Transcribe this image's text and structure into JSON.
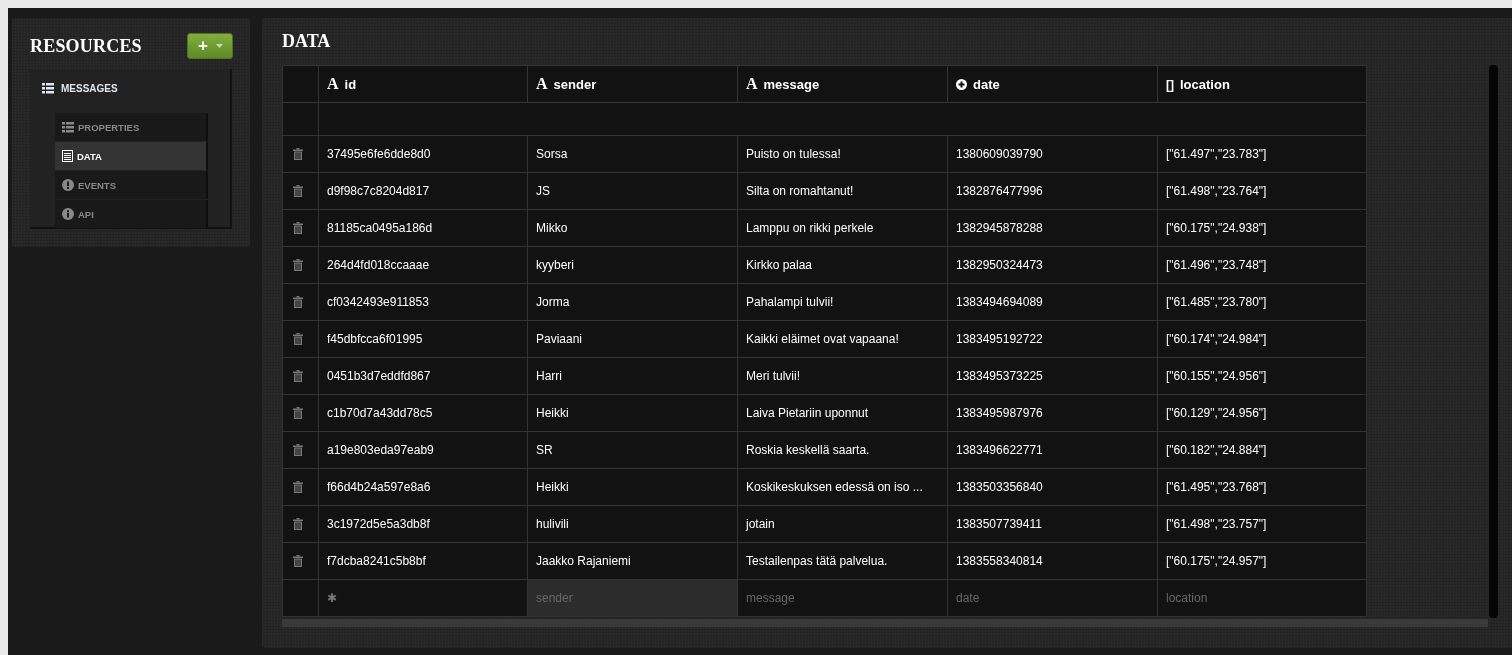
{
  "sidebar": {
    "title": "RESOURCES",
    "add_button": {
      "label": "+"
    },
    "resources": [
      {
        "label": "MESSAGES",
        "kind": "list",
        "children": [
          {
            "label": "PROPERTIES",
            "kind": "list",
            "selected": false
          },
          {
            "label": "DATA",
            "kind": "table",
            "selected": true
          },
          {
            "label": "EVENTS",
            "kind": "alert",
            "selected": false
          },
          {
            "label": "API",
            "kind": "info",
            "selected": false
          }
        ]
      }
    ]
  },
  "main": {
    "title": "DATA",
    "table": {
      "columns": [
        {
          "label": "id",
          "kind": "string",
          "glyph": "A"
        },
        {
          "label": "sender",
          "kind": "string",
          "glyph": "A"
        },
        {
          "label": "message",
          "kind": "string",
          "glyph": "A"
        },
        {
          "label": "date",
          "kind": "number"
        },
        {
          "label": "location",
          "kind": "array",
          "glyph": "[]"
        }
      ],
      "rows": [
        [
          "37495e6fe6dde8d0",
          "Sorsa",
          "Puisto on tulessa!",
          "1380609039790",
          "[\"61.497\",\"23.783\"]"
        ],
        [
          "d9f98c7c8204d817",
          "JS",
          "Silta on romahtanut!",
          "1382876477996",
          "[\"61.498\",\"23.764\"]"
        ],
        [
          "81185ca0495a186d",
          "Mikko",
          "Lamppu on rikki perkele",
          "1382945878288",
          "[\"60.175\",\"24.938\"]"
        ],
        [
          "264d4fd018ccaaae",
          "kyyberi",
          "Kirkko palaa",
          "1382950324473",
          "[\"61.496\",\"23.748\"]"
        ],
        [
          "cf0342493e911853",
          "Jorma",
          "Pahalampi tulvii!",
          "1383494694089",
          "[\"61.485\",\"23.780\"]"
        ],
        [
          "f45dbfcca6f01995",
          "Paviaani",
          "Kaikki eläimet ovat vapaana!",
          "1383495192722",
          "[\"60.174\",\"24.984\"]"
        ],
        [
          "0451b3d7eddfd867",
          "Harri",
          "Meri tulvii!",
          "1383495373225",
          "[\"60.155\",\"24.956\"]"
        ],
        [
          "c1b70d7a43dd78c5",
          "Heikki",
          "Laiva Pietariin uponnut",
          "1383495987976",
          "[\"60.129\",\"24.956\"]"
        ],
        [
          "a19e803eda97eab9",
          "SR",
          "Roskia keskellä saarta.",
          "1383496622771",
          "[\"60.182\",\"24.884\"]"
        ],
        [
          "f66d4b24a597e8a6",
          "Heikki",
          "Koskikeskuksen edessä on iso ...",
          "1383503356840",
          "[\"61.495\",\"23.768\"]"
        ],
        [
          "3c1972d5e5a3db8f",
          "hulivili",
          "jotain",
          "1383507739411",
          "[\"61.498\",\"23.757\"]"
        ],
        [
          "f7dcba8241c5b8bf",
          "Jaakko Rajaniemi",
          "Testailenpas tätä palvelua.",
          "1383558340814",
          "[\"60.175\",\"24.957\"]"
        ]
      ],
      "new_row": {
        "id_glyph": "✱",
        "fields": [
          {
            "placeholder": "sender",
            "focused": true
          },
          {
            "placeholder": "message",
            "focused": false
          },
          {
            "placeholder": "date",
            "focused": false
          },
          {
            "placeholder": "location",
            "focused": false
          }
        ]
      }
    }
  }
}
